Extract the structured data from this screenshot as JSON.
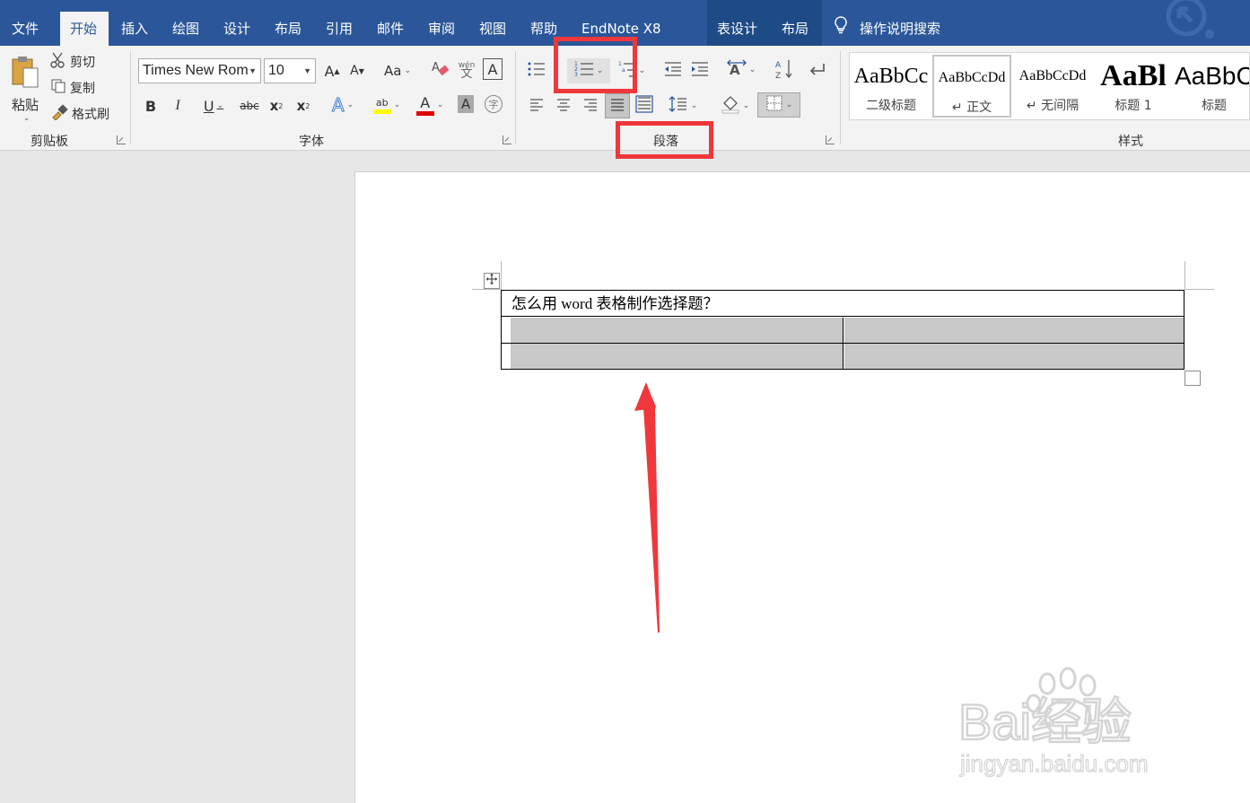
{
  "tabs": [
    {
      "label": "文件"
    },
    {
      "label": "开始"
    },
    {
      "label": "插入"
    },
    {
      "label": "绘图"
    },
    {
      "label": "设计"
    },
    {
      "label": "布局"
    },
    {
      "label": "引用"
    },
    {
      "label": "邮件"
    },
    {
      "label": "审阅"
    },
    {
      "label": "视图"
    },
    {
      "label": "帮助"
    },
    {
      "label": "EndNote X8"
    },
    {
      "label": "表设计"
    },
    {
      "label": "布局"
    }
  ],
  "tell_me": "操作说明搜索",
  "clipboard": {
    "paste": "粘贴",
    "cut": "剪切",
    "copy": "复制",
    "format_painter": "格式刷",
    "group_label": "剪贴板"
  },
  "font": {
    "font_name": "Times New Rom",
    "font_size": "10",
    "grow": "A",
    "shrink": "A",
    "change_case": "Aa",
    "phonetic": "wén",
    "border_char": "A",
    "bold": "B",
    "italic": "I",
    "underline": "U",
    "strike": "abc",
    "subscript": "x",
    "superscript": "x",
    "text_effects": "A",
    "highlight": "ab",
    "font_color": "A",
    "char_shading": "A",
    "enclose": "字",
    "group_label": "字体"
  },
  "paragraph": {
    "group_label": "段落"
  },
  "styles": {
    "items": [
      {
        "sample": "AaBbCc",
        "name": "二级标题"
      },
      {
        "sample": "AaBbCcDd",
        "name": "↵ 正文"
      },
      {
        "sample": "AaBbCcDd",
        "name": "↵ 无间隔"
      },
      {
        "sample": "AaBl",
        "name": "标题 1"
      },
      {
        "sample": "AaBbC",
        "name": "标题"
      }
    ],
    "group_label": "样式"
  },
  "document": {
    "table_title": "怎么用 word 表格制作选择题？"
  },
  "watermark": {
    "brand": "Bai经验",
    "url": "jingyan.baidu.com"
  },
  "colors": {
    "tabbar": "#2b579a",
    "highlight_box": "#f0373b",
    "arrow": "#f0373b",
    "cell_shading": "#c8c8c8"
  }
}
